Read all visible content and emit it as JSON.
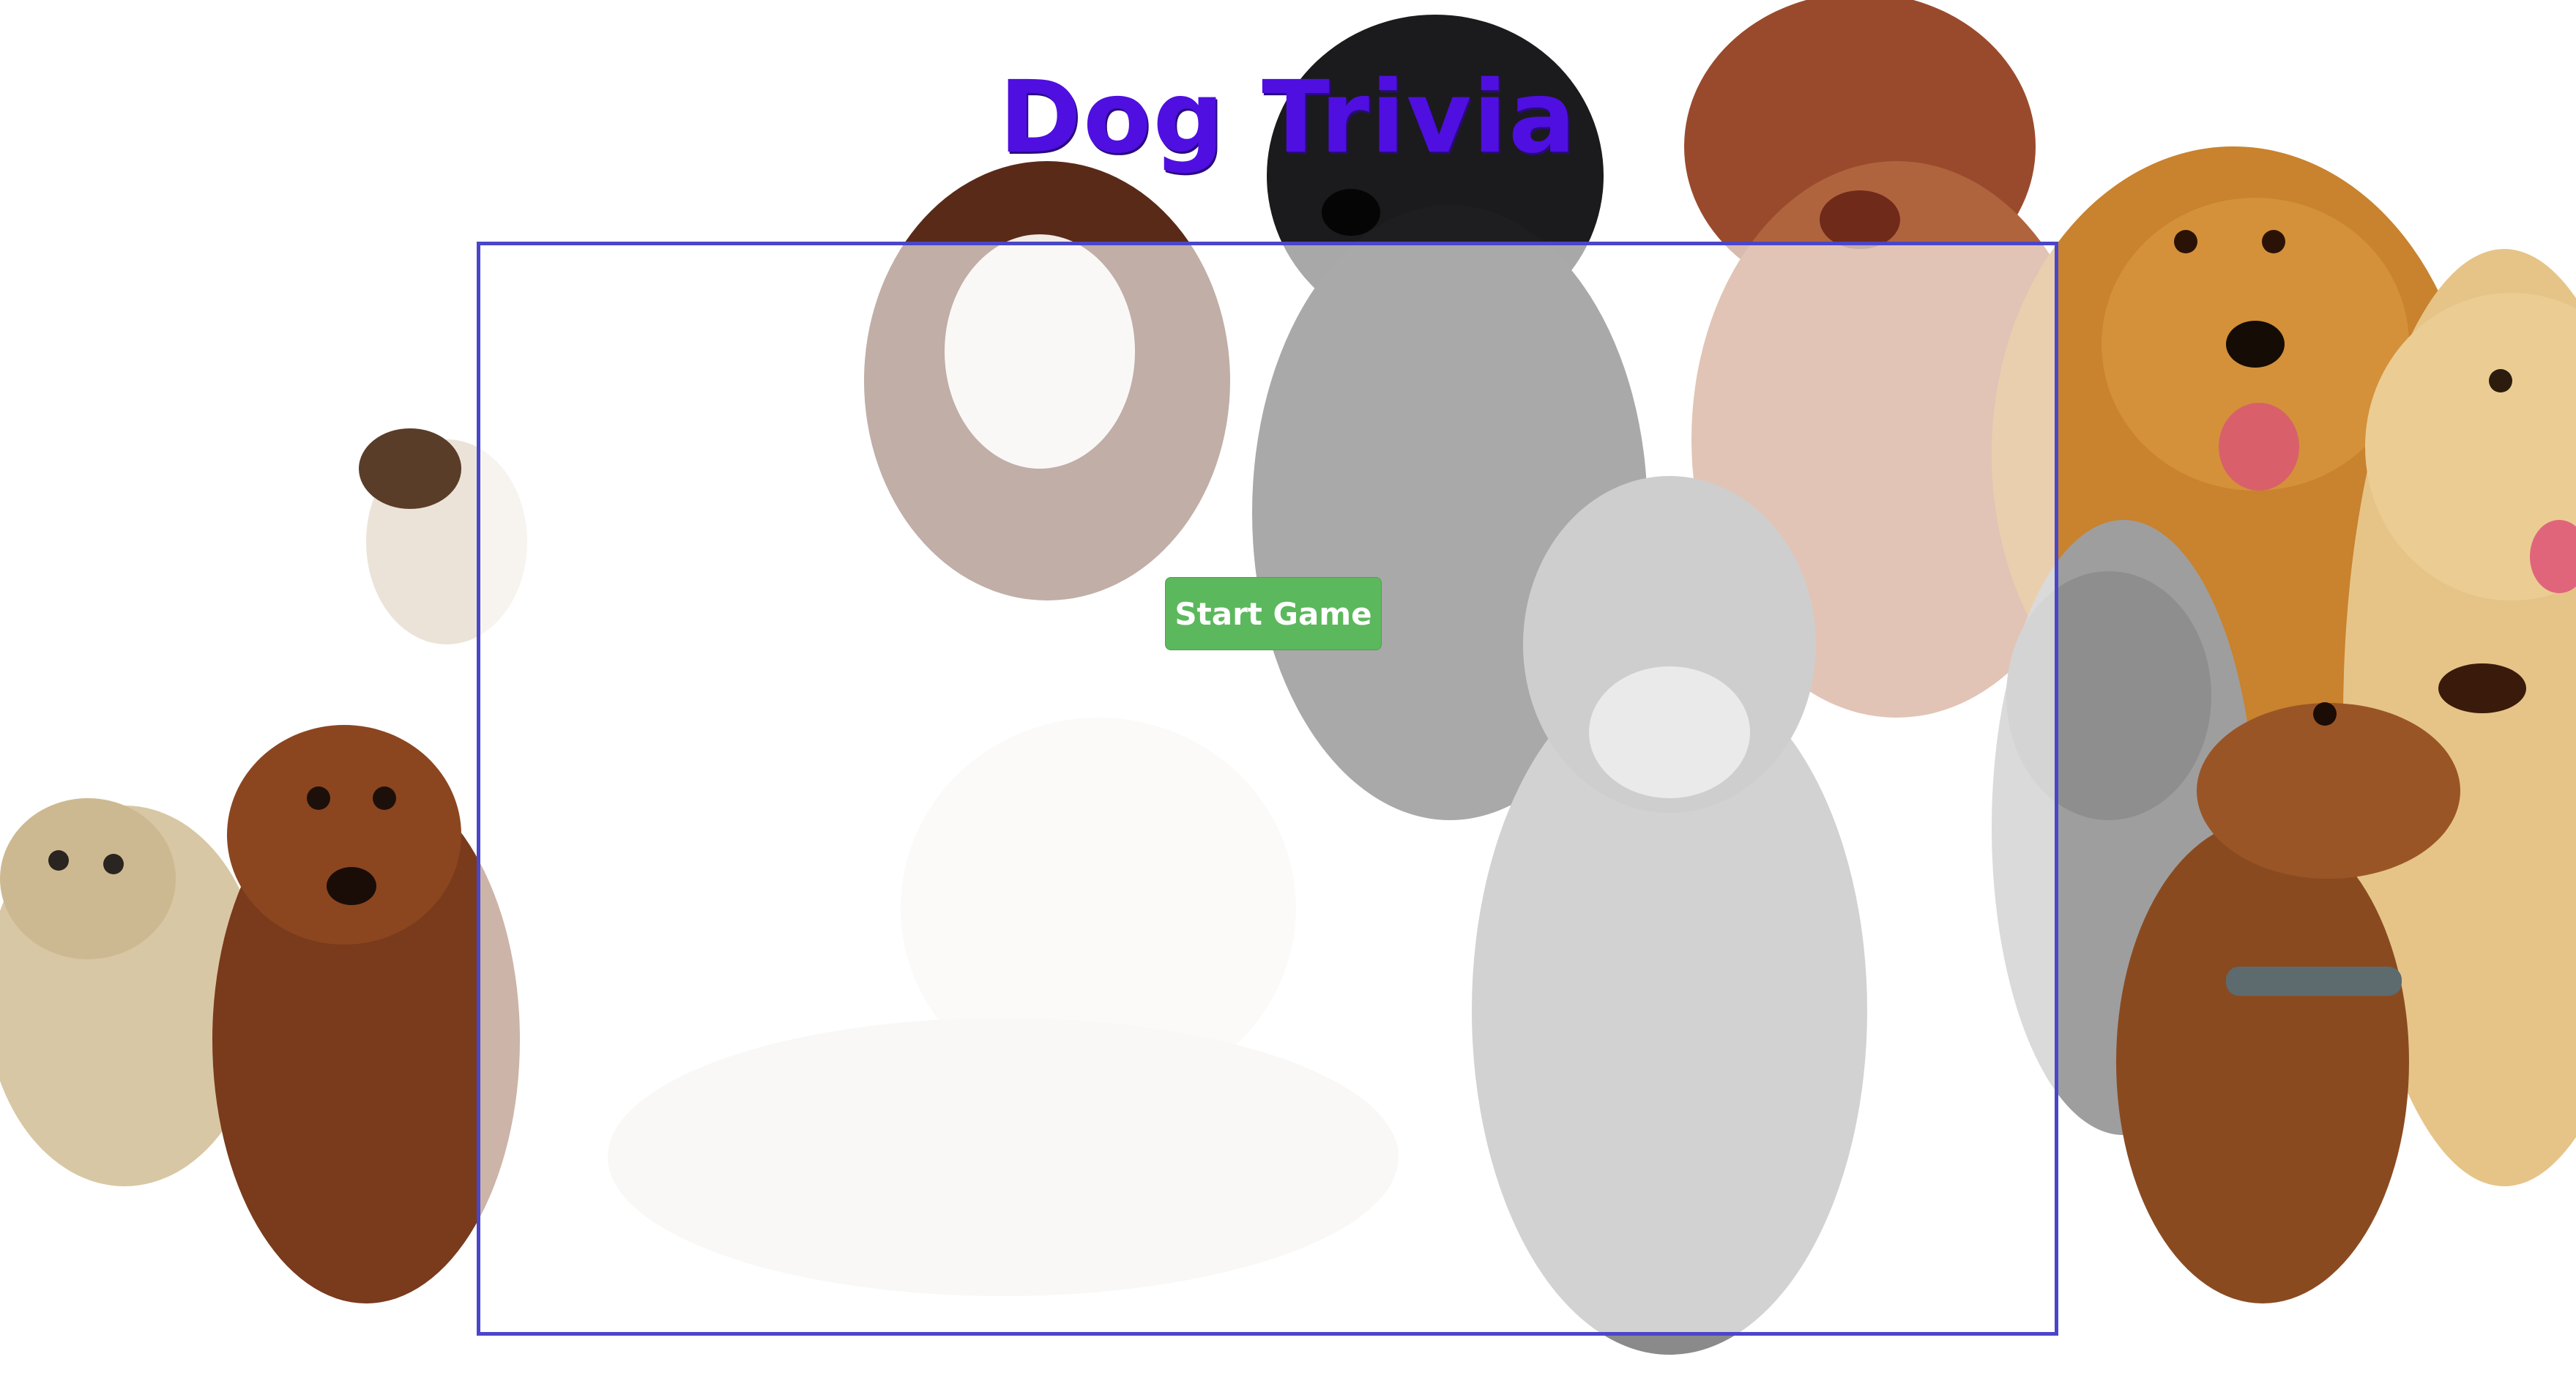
{
  "page": {
    "title": "Dog Trivia"
  },
  "game": {
    "start_button_label": "Start Game"
  },
  "colors": {
    "title": "#4f0fe0",
    "panel_border": "#4b46c9",
    "button_bg": "#5cb85c",
    "button_text": "#ffffff"
  }
}
